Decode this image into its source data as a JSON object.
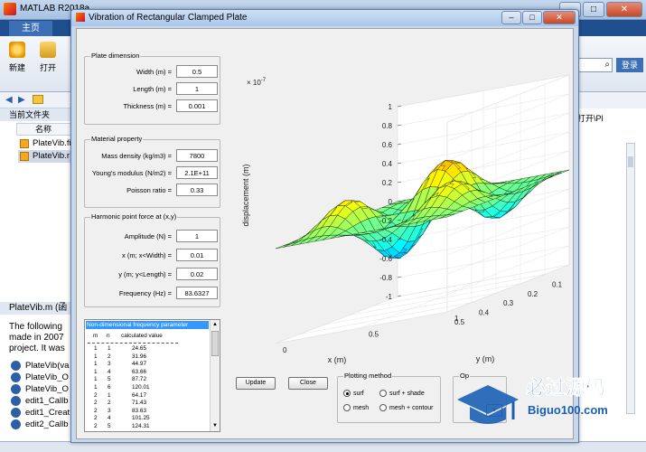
{
  "matlab": {
    "title": "MATLAB R2018a",
    "tab_main": "主页",
    "toolbar_new": "新建",
    "toolbar_open": "打开",
    "login": "登录",
    "current_folder_label": "当前文件夹",
    "col_name": "名称",
    "files": [
      "PlateVib.fi",
      "PlateVib.r"
    ],
    "detail_title": "PlateVib.m (函",
    "detail_text": [
      "The following",
      "made in 2007",
      "project. It was"
    ],
    "functions": [
      "PlateVib(va",
      "PlateVib_O",
      "PlateVib_O",
      "edit1_Callb",
      "edit1_Creat",
      "edit2_Callb"
    ],
    "right_open": "打开\\Pl"
  },
  "figure": {
    "title": "Vibration of Rectangular Clamped Plate",
    "plate_dimension": {
      "title": "Plate dimension",
      "fields": [
        {
          "label": "Width (m) =",
          "value": "0.5"
        },
        {
          "label": "Length (m) =",
          "value": "1"
        },
        {
          "label": "Thickness (m) =",
          "value": "0.001"
        }
      ]
    },
    "material_property": {
      "title": "Material property",
      "fields": [
        {
          "label": "Mass density (kg/m3) =",
          "value": "7800"
        },
        {
          "label": "Young's modulus (N/m2) =",
          "value": "2.1E+11"
        },
        {
          "label": "Poisson ratio =",
          "value": "0.33"
        }
      ]
    },
    "harmonic_force": {
      "title": "Harmonic point force at (x,y)",
      "fields": [
        {
          "label": "Amplitude (N) =",
          "value": "1"
        },
        {
          "label": "x (m; x<Width) =",
          "value": "0.01"
        },
        {
          "label": "y (m; y<Length) =",
          "value": "0.02"
        },
        {
          "label": "Frequency (Hz) =",
          "value": "83.6327"
        }
      ]
    },
    "freq_list": {
      "header": "Non-dimensional frequency parameter",
      "col_m": "m",
      "col_n": "n",
      "col_value": "calculated value",
      "rows": [
        [
          "1",
          "1",
          "24.65"
        ],
        [
          "1",
          "2",
          "31.96"
        ],
        [
          "1",
          "3",
          "44.97"
        ],
        [
          "1",
          "4",
          "63.66"
        ],
        [
          "1",
          "5",
          "87.72"
        ],
        [
          "1",
          "6",
          "120.01"
        ],
        [
          "2",
          "1",
          "64.17"
        ],
        [
          "2",
          "2",
          "71.43"
        ],
        [
          "2",
          "3",
          "83.63"
        ],
        [
          "2",
          "4",
          "101.25"
        ],
        [
          "2",
          "5",
          "124.31"
        ]
      ]
    },
    "update_button": "Update",
    "close_button": "Close",
    "plotting": {
      "title": "Plotting method",
      "options": [
        "surf",
        "surf + shade",
        "mesh",
        "mesh + contour"
      ],
      "selected": "surf"
    },
    "extra_group_title": "Op"
  },
  "plot": {
    "exponent_base": "× 10",
    "exponent": "-7",
    "zlabel": "displacement (m)",
    "xlabel": "x (m)",
    "ylabel": "y (m)",
    "z_ticks": [
      "1",
      "0.8",
      "0.6",
      "0.4",
      "0.2",
      "0",
      "-0.2",
      "-0.4",
      "-0.6",
      "-0.8",
      "-1"
    ],
    "x_ticks": [
      "0",
      "0.1",
      "0.2",
      "0.3",
      "0.4",
      "0.5"
    ],
    "y_ticks": [
      "0",
      "0.5",
      "1"
    ]
  },
  "watermark": {
    "text": "必过源码",
    "url": "Biguo100.com"
  }
}
